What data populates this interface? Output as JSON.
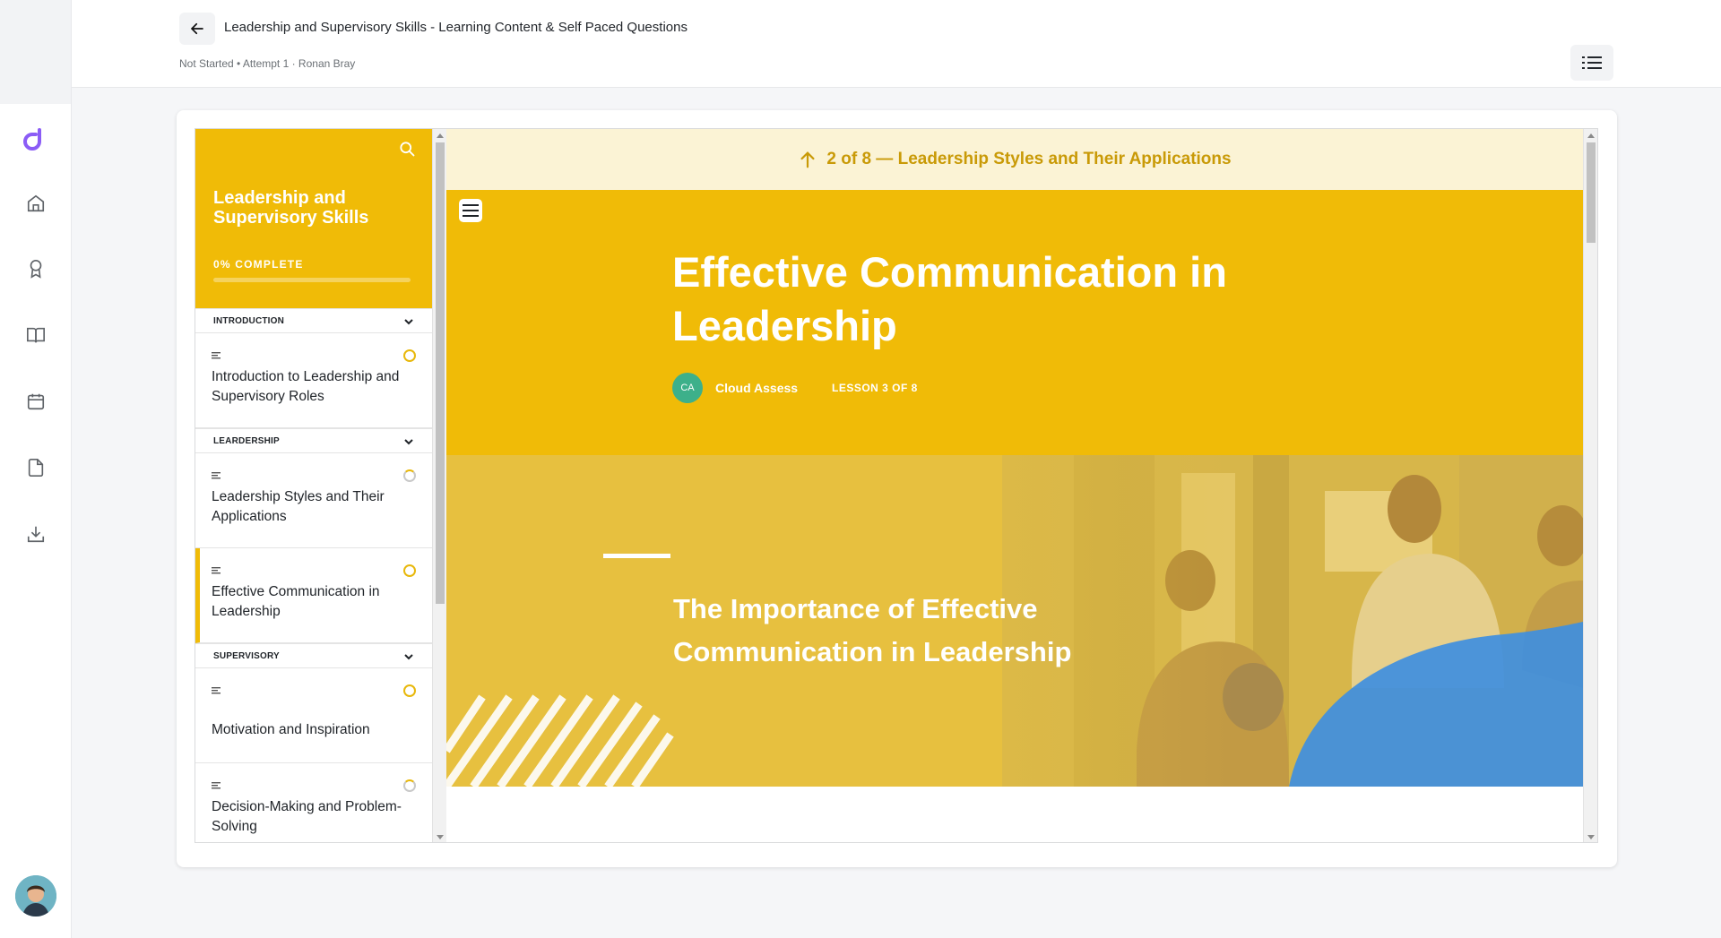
{
  "header": {
    "title": "Leadership and Supervisory Skills - Learning Content & Self Paced Questions",
    "meta": "Not Started • Attempt 1 · Ronan Bray"
  },
  "course": {
    "title": "Leadership and Supervisory Skills",
    "progress_label": "0% COMPLETE",
    "progress_percent": 0
  },
  "sections": [
    {
      "label": "INTRODUCTION"
    },
    {
      "label": "LEARDERSHIP"
    },
    {
      "label": "SUPERVISORY"
    }
  ],
  "lessons": [
    {
      "title": "Introduction to Leadership and Supervisory Roles",
      "status": "in-progress"
    },
    {
      "title": "Leadership Styles and Their Applications",
      "status": "not-started"
    },
    {
      "title": "Effective Communication in Leadership",
      "status": "in-progress",
      "active": true
    },
    {
      "title": "Motivation and Inspiration",
      "status": "in-progress"
    },
    {
      "title": "Decision-Making and Problem-Solving",
      "status": "not-started"
    }
  ],
  "content": {
    "prev_label": "2 of 8 — Leadership Styles and Their Applications",
    "title": "Effective Communication in Leadership",
    "author_initials": "CA",
    "author_name": "Cloud Assess",
    "lesson_count": "LESSON 3 OF 8",
    "banner_title": "The Importance of Effective Communication in Leadership"
  },
  "colors": {
    "accent": "#f0bb07",
    "banner": "#e7c03f",
    "prev_bar": "#fbf3d5",
    "banner_blue": "#3f8fe0",
    "brand": "#8b5cf6"
  },
  "icons": {
    "rail": [
      "logo-icon",
      "home-icon",
      "award-icon",
      "book-icon",
      "calendar-icon",
      "file-icon",
      "download-icon"
    ]
  }
}
